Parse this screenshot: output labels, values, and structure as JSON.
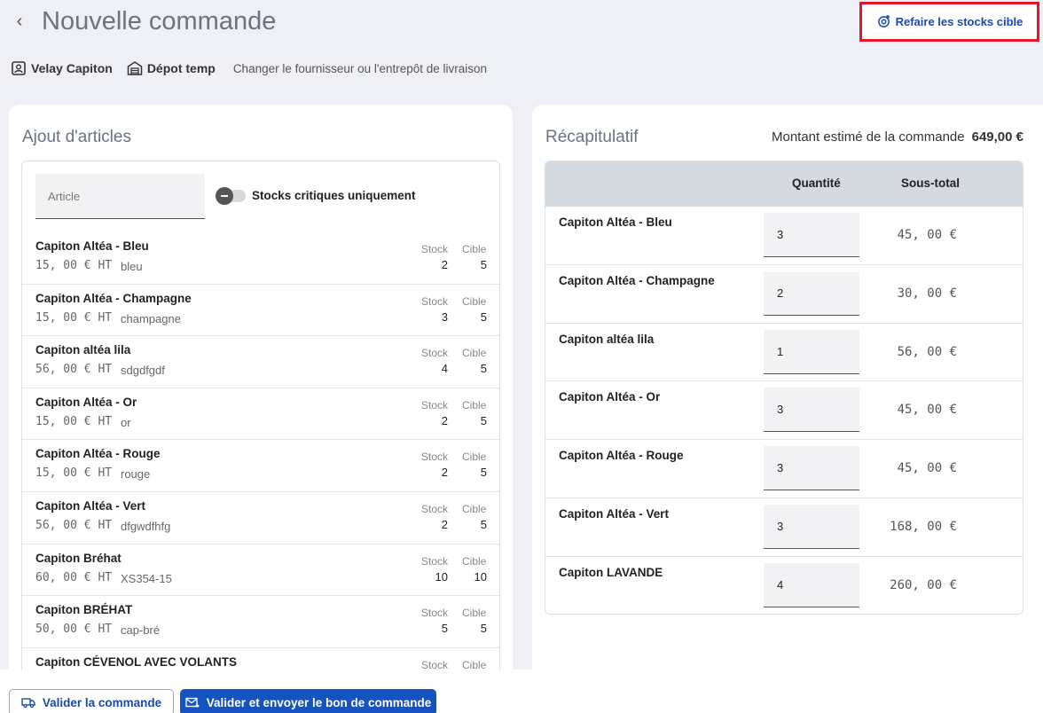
{
  "header": {
    "back_glyph": "‹",
    "title": "Nouvelle commande",
    "redo_label": "Refaire les stocks cible"
  },
  "meta": {
    "supplier": "Velay Capiton",
    "warehouse": "Dépot temp",
    "change_link": "Changer le fournisseur ou l'entrepôt de livraison"
  },
  "left": {
    "title": "Ajout d'articles",
    "search_placeholder": "Article",
    "toggle_label": "Stocks critiques uniquement",
    "stock_header": "Stock",
    "cible_header": "Cible",
    "items": [
      {
        "name": "Capiton Altéa - Bleu",
        "price": "15, 00 € HT",
        "ref": "bleu",
        "stock": "2",
        "cible": "5"
      },
      {
        "name": "Capiton Altéa - Champagne",
        "price": "15, 00 € HT",
        "ref": "champagne",
        "stock": "3",
        "cible": "5"
      },
      {
        "name": "Capiton altéa lila",
        "price": "56, 00 € HT",
        "ref": "sdgdfgdf",
        "stock": "4",
        "cible": "5"
      },
      {
        "name": "Capiton Altéa - Or",
        "price": "15, 00 € HT",
        "ref": "or",
        "stock": "2",
        "cible": "5"
      },
      {
        "name": "Capiton Altéa - Rouge",
        "price": "15, 00 € HT",
        "ref": "rouge",
        "stock": "2",
        "cible": "5"
      },
      {
        "name": "Capiton Altéa - Vert",
        "price": "56, 00 € HT",
        "ref": "dfgwdfhfg",
        "stock": "2",
        "cible": "5"
      },
      {
        "name": "Capiton Bréhat",
        "price": "60, 00 € HT",
        "ref": "XS354-15",
        "stock": "10",
        "cible": "10"
      },
      {
        "name": "Capiton BRÉHAT",
        "price": "50, 00 € HT",
        "ref": "cap-bré",
        "stock": "5",
        "cible": "5"
      },
      {
        "name": "Capiton CÉVENOL AVEC VOLANTS",
        "price": "",
        "ref": "",
        "stock": "",
        "cible": ""
      }
    ]
  },
  "right": {
    "title": "Récapitulatif",
    "total_label": "Montant estimé de la commande",
    "total_value": "649,00 €",
    "qty_header": "Quantité",
    "subtotal_header": "Sous-total",
    "rows": [
      {
        "name": "Capiton Altéa - Bleu",
        "qty": "3",
        "subtotal": "45, 00 €"
      },
      {
        "name": "Capiton Altéa - Champagne",
        "qty": "2",
        "subtotal": "30, 00 €"
      },
      {
        "name": "Capiton altéa lila",
        "qty": "1",
        "subtotal": "56, 00 €"
      },
      {
        "name": "Capiton Altéa - Or",
        "qty": "3",
        "subtotal": "45, 00 €"
      },
      {
        "name": "Capiton Altéa - Rouge",
        "qty": "3",
        "subtotal": "45, 00 €"
      },
      {
        "name": "Capiton Altéa - Vert",
        "qty": "3",
        "subtotal": "168, 00 €"
      },
      {
        "name": "Capiton LAVANDE",
        "qty": "4",
        "subtotal": "260, 00 €"
      }
    ]
  },
  "footer": {
    "validate_label": "Valider la commande",
    "validate_send_label": "Valider et envoyer le bon de commande"
  },
  "colors": {
    "accent": "#1553c0",
    "highlight_border": "#e3162b",
    "background": "#eef0f5"
  }
}
